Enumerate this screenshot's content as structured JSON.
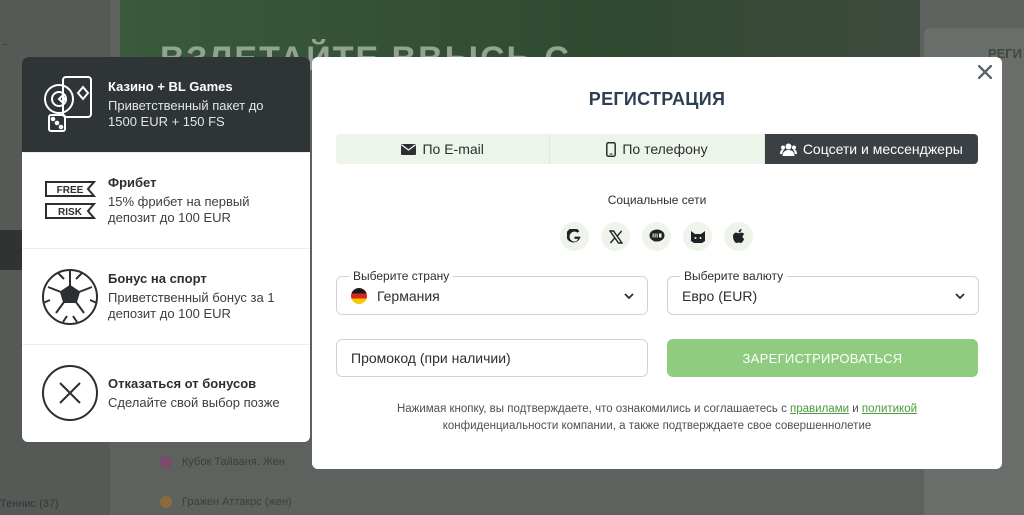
{
  "background": {
    "banner_text": "ВЗЛЕТАЙТЕ ВВЫСЬ С",
    "right_label": "РЕГИ",
    "rows": [
      "Кубок Тайваня. Жен",
      "Гражен Аттакрс (жен)"
    ],
    "left_bottom": "Теннис (37)",
    "left_top": "~"
  },
  "bonuses": [
    {
      "title": "Казино + BL Games",
      "desc": "Приветственный пакет до 1500 EUR + 150 FS",
      "icon": "casino-chips-icon",
      "active": true
    },
    {
      "title": "Фрибет",
      "desc": "15% фрибет на первый депозит до 100 EUR",
      "icon": "free-risk-icon",
      "active": false
    },
    {
      "title": "Бонус на спорт",
      "desc": "Приветственный бонус за 1 депозит до 100 EUR",
      "icon": "soccer-ball-icon",
      "active": false
    },
    {
      "title": "Отказаться от бонусов",
      "desc": "Сделайте свой выбор позже",
      "icon": "x-circle-icon",
      "active": false
    }
  ],
  "free_risk": {
    "free": "FREE",
    "risk": "RISK"
  },
  "modal": {
    "title": "РЕГИСТРАЦИЯ",
    "tabs": [
      {
        "label": "По E-mail",
        "icon": "envelope-icon"
      },
      {
        "label": "По телефону",
        "icon": "phone-icon"
      },
      {
        "label": "Соцсети и мессенджеры",
        "icon": "users-icon"
      }
    ],
    "active_tab": 2,
    "social_label": "Социальные сети",
    "socials": [
      "google-icon",
      "x-twitter-icon",
      "line-icon",
      "mailru-icon",
      "apple-icon"
    ],
    "country": {
      "legend": "Выберите страну",
      "value": "Германия"
    },
    "currency": {
      "legend": "Выберите валюту",
      "value": "Евро (EUR)"
    },
    "promo_placeholder": "Промокод (при наличии)",
    "register_label": "ЗАРЕГИСТРИРОВАТЬСЯ",
    "legal": {
      "part1": "Нажимая кнопку, вы подтверждаете, что ознакомились и соглашаетесь с ",
      "link1": "правилами",
      "part2": " и ",
      "link2": "политикой",
      "part3": " конфиденциальности компании, а также подтверждаете свое совершеннолетие"
    }
  },
  "colors": {
    "accent": "#8fcc7f",
    "dark": "#3b4044",
    "link": "#4c9a3c",
    "title": "#2d3f52"
  }
}
